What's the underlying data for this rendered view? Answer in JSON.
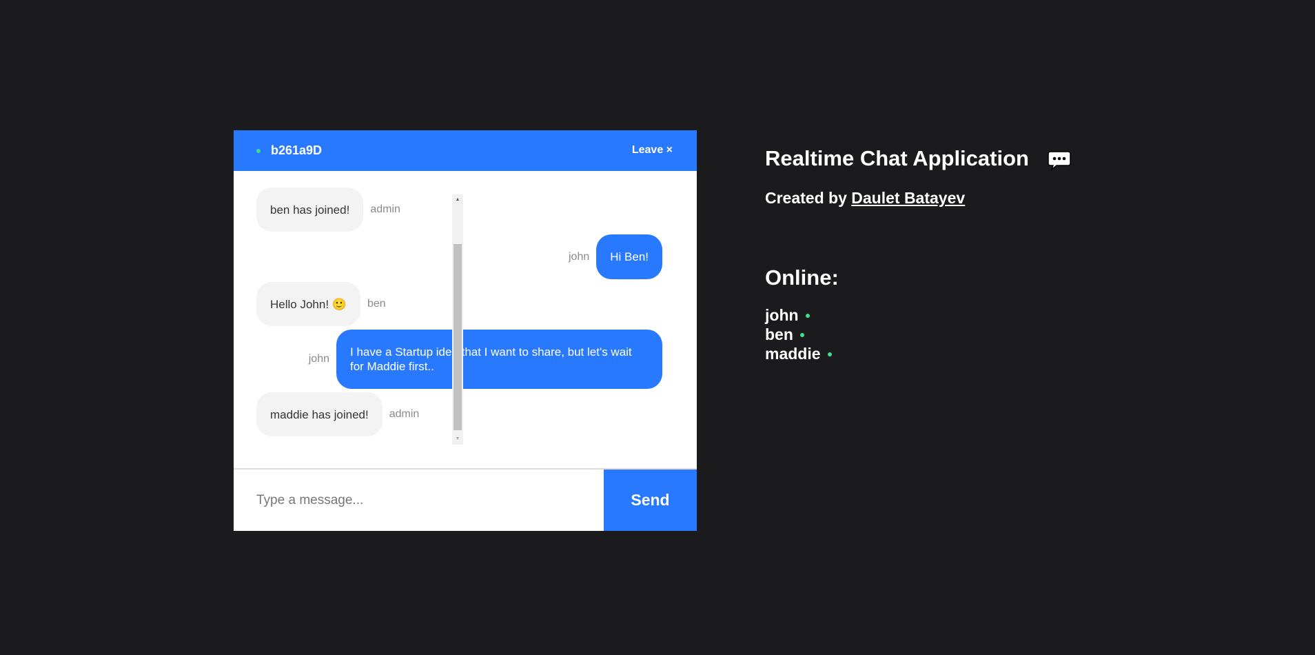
{
  "chat": {
    "room_name": "b261a9D",
    "leave_label": "Leave ×",
    "messages": [
      {
        "text": "ben has joined!",
        "sender": "admin",
        "own": false
      },
      {
        "text": "Hi Ben!",
        "sender": "john",
        "own": true
      },
      {
        "text": "Hello John! 🙂",
        "sender": "ben",
        "own": false
      },
      {
        "text": "I have a Startup idea that I want to share, but let's wait for Maddie first..",
        "sender": "john",
        "own": true
      },
      {
        "text": "maddie has joined!",
        "sender": "admin",
        "own": false
      }
    ],
    "input_placeholder": "Type a message...",
    "input_value": "",
    "send_label": "Send"
  },
  "info": {
    "title": "Realtime Chat Application",
    "created_prefix": "Created by",
    "author": "Daulet Batayev",
    "online_title": "Online:",
    "users": [
      "john",
      "ben",
      "maddie"
    ]
  },
  "colors": {
    "background": "#1b1b1d",
    "accent": "#2979ff",
    "online": "#3ce08f",
    "incoming_bubble": "#f3f3f3"
  },
  "icons": {
    "header_status": "online-dot-icon",
    "title_icon": "speech-bubble-icon",
    "scroll_up": "arrow-up-icon",
    "scroll_down": "arrow-down-icon"
  }
}
